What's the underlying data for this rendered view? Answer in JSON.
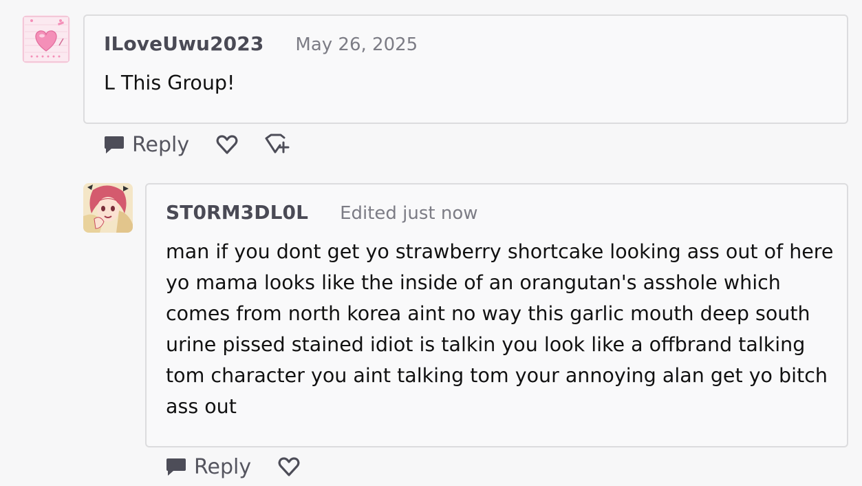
{
  "comments": [
    {
      "author": "ILoveUwu2023",
      "date": "May 26, 2025",
      "body": [
        "L This Group!"
      ],
      "avatar_icon": "pink-heart-avatar",
      "actions": {
        "reply_label": "Reply"
      }
    },
    {
      "author": "ST0RM3DL0L",
      "date": "Edited just now",
      "body": [
        "man if you dont get yo strawberry shortcake looking ass out of here",
        "yo mama looks like the inside of an orangutan's asshole which",
        "comes from north korea aint no way this garlic mouth deep south",
        "urine pissed stained idiot is talkin you look like a offbrand talking",
        "tom character you aint talking tom your annoying alan get yo bitch",
        "ass out"
      ],
      "avatar_icon": "anime-character-avatar",
      "actions": {
        "reply_label": "Reply"
      }
    }
  ],
  "colors": {
    "card_border": "#dcdcde",
    "author": "#4a4a55",
    "meta": "#7c7c85",
    "icon": "#4d4d58"
  }
}
